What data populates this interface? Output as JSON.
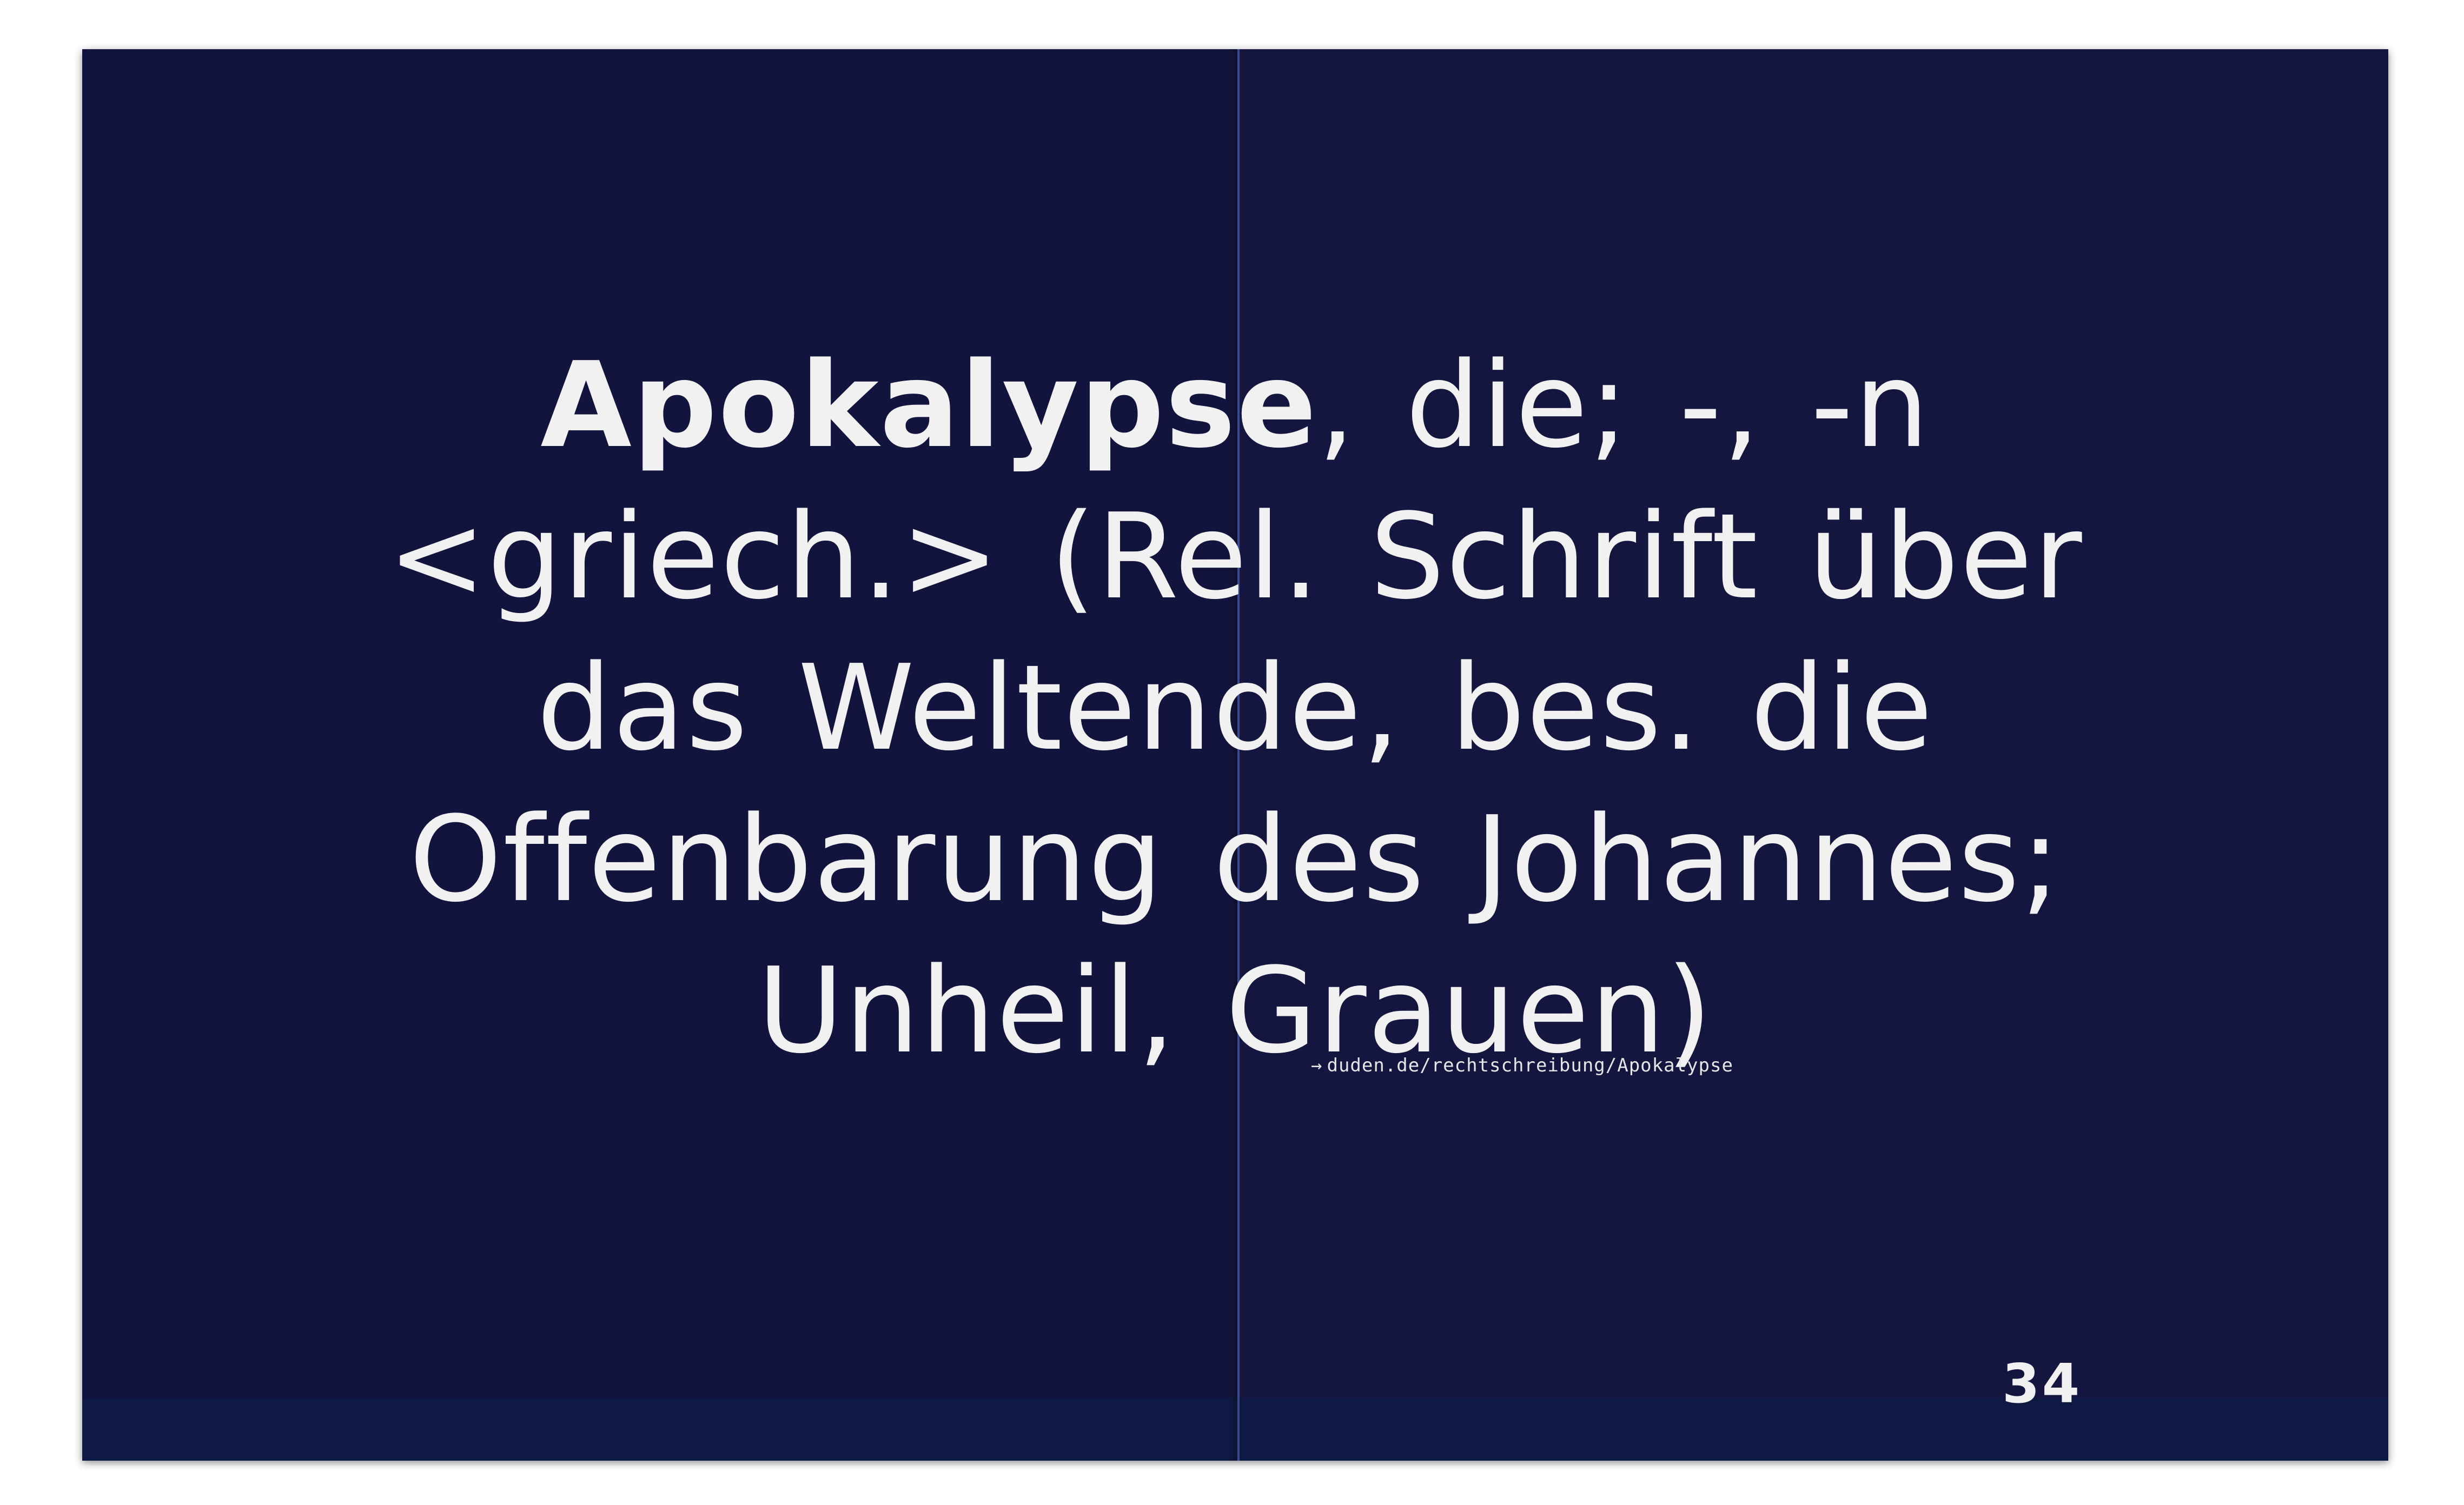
{
  "entry": {
    "headword": "Apokalypse",
    "line1_rest": ", die; -, -n",
    "line2": "<griech.> (Rel. Schrift über",
    "line3": "das Weltende, bes. die",
    "line4": "Offenbarung des Johannes;",
    "line5": "Unheil, Grauen)"
  },
  "source": {
    "arrow": "→",
    "link": "duden.de/rechtschreibung/Apokalypse"
  },
  "page_number": "34",
  "colors": {
    "background": "#15163f",
    "text": "#f1f1f1",
    "bottom_band": "#0f1a44"
  }
}
